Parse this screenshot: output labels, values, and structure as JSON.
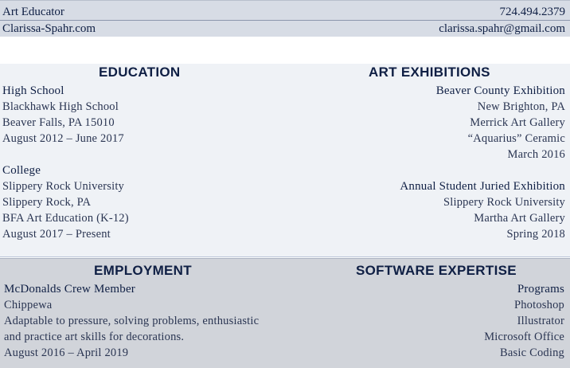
{
  "header": {
    "title": "Art Educator",
    "phone": "724.494.2379",
    "website": "Clarissa-Spahr.com",
    "email": "clarissa.spahr@gmail.com"
  },
  "education": {
    "heading": "EDUCATION",
    "high_school": {
      "title": "High School",
      "lines": [
        "Blackhawk High School",
        "Beaver Falls, PA 15010",
        "August 2012 – June 2017"
      ]
    },
    "college": {
      "title": "College",
      "lines": [
        "Slippery Rock University",
        "Slippery Rock, PA",
        "BFA Art Education (K-12)",
        "August 2017 – Present"
      ]
    }
  },
  "exhibitions": {
    "heading": "ART EXHIBITIONS",
    "first": {
      "title": "Beaver County Exhibition",
      "lines": [
        "New Brighton, PA",
        "Merrick Art Gallery",
        "“Aquarius” Ceramic",
        "March 2016"
      ]
    },
    "second": {
      "title": "Annual Student Juried Exhibition",
      "lines": [
        "Slippery Rock University",
        "Martha Art Gallery",
        "Spring 2018"
      ]
    }
  },
  "employment": {
    "heading": "EMPLOYMENT",
    "job": {
      "title": "McDonalds Crew Member",
      "lines": [
        "Chippewa",
        "Adaptable to pressure, solving problems, enthusiastic",
        "and practice art skills for decorations.",
        "August 2016 – April 2019"
      ]
    }
  },
  "software": {
    "heading": "SOFTWARE EXPERTISE",
    "title": "Programs",
    "items": [
      "Photoshop",
      "Illustrator",
      "Microsoft Office",
      "Basic Coding"
    ]
  }
}
